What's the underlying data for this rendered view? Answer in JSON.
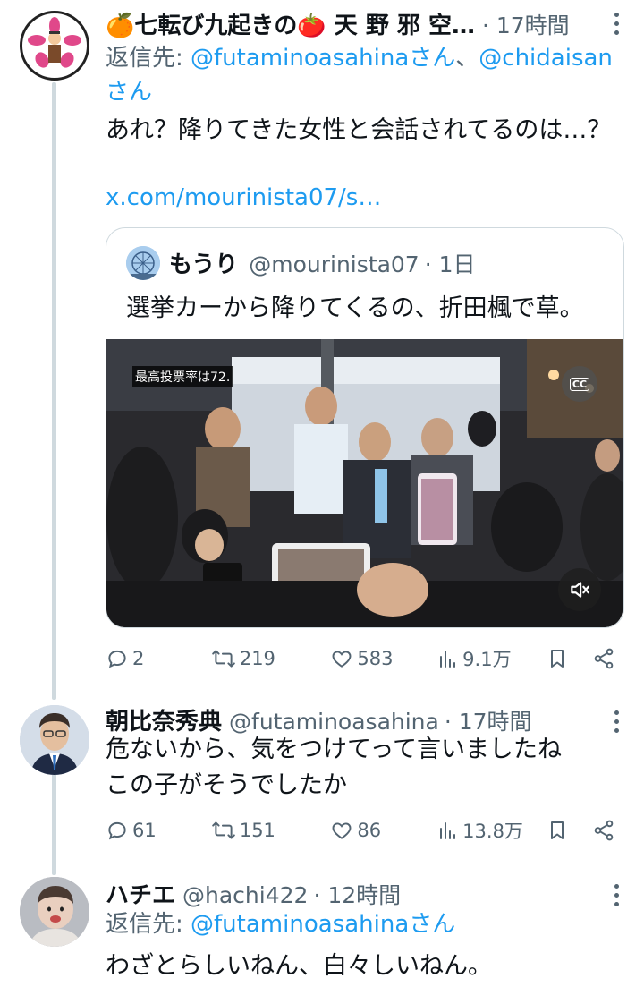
{
  "tweets": [
    {
      "name": "🍊七転び九起きの🍅 天 野 邪 空…",
      "meta": "· 17時間",
      "reply_prefix": "返信先: ",
      "reply_mention1": "@futaminoasahinaさん",
      "reply_sep": "、",
      "reply_mention2": "@chidaisan",
      "reply_mention2_suffix": "さん",
      "text": "あれ？降りてきた女性と会話されてるのは…？",
      "link": "x.com/mourinista07/s…",
      "quote": {
        "name": "もうり",
        "handle": "@mourinista07",
        "meta": "· 1日",
        "text": "選挙カーから降りてくるの、折田楓で草。",
        "caption_chip": "最高投票率は72.",
        "cc_label": "CC"
      },
      "actions": {
        "replies": "2",
        "reposts": "219",
        "likes": "583",
        "views": "9.1万"
      }
    },
    {
      "name": "朝比奈秀典",
      "handle": "@futaminoasahina",
      "meta": "· 17時間",
      "text": "危ないから、気をつけてって言いましたね\nこの子がそうでしたか",
      "actions": {
        "replies": "61",
        "reposts": "151",
        "likes": "86",
        "views": "13.8万"
      }
    },
    {
      "name": "ハチエ",
      "handle": "@hachi422",
      "meta": "· 12時間",
      "reply_prefix": "返信先: ",
      "reply_mention1": "@futaminoasahinaさん",
      "text": "わざとらしいねん、白々しいねん。"
    }
  ]
}
